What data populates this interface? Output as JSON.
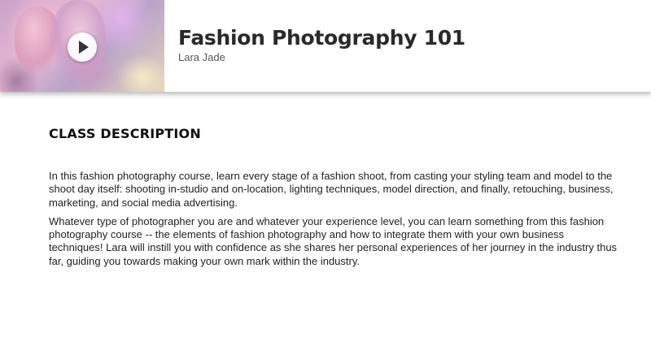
{
  "header": {
    "title": "Fashion Photography 101",
    "instructor": "Lara Jade",
    "thumbnail_icon": "play-icon"
  },
  "description": {
    "heading": "CLASS DESCRIPTION",
    "paragraphs": [
      "In this fashion photography course, learn every stage of a fashion shoot, from casting your styling team and model to the shoot day itself: shooting in-studio and on-location, lighting techniques, model direction, and finally, retouching, business, marketing, and social media advertising.",
      "Whatever type of photographer you are and whatever your experience level, you can learn something from this fashion photography course -- the elements of fashion photography and how to integrate them with your own business techniques! Lara will instill you with confidence as she shares her personal experiences of her journey in the industry thus far, guiding you towards making your own mark within the industry."
    ]
  },
  "colors": {
    "title_text": "#2a2a2a",
    "body_text": "#222222",
    "subtle_text": "#555555",
    "background": "#ffffff"
  }
}
